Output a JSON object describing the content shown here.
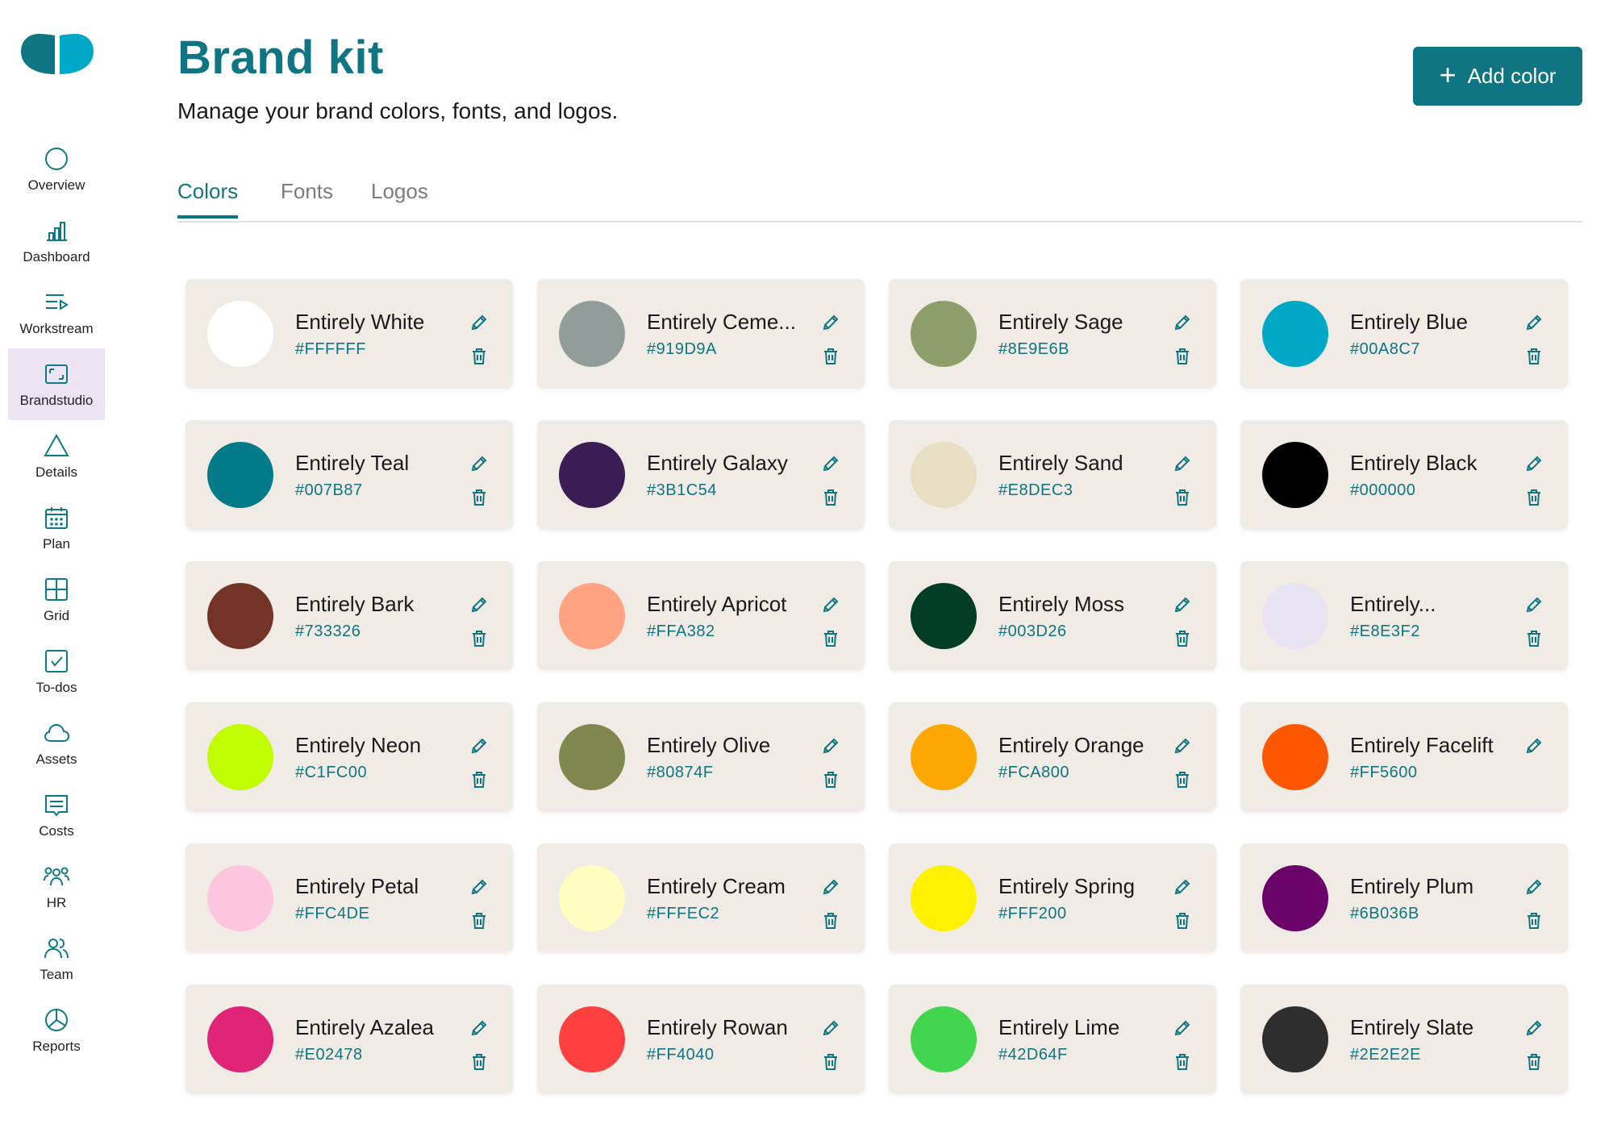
{
  "sidebar": {
    "items": [
      {
        "label": "Overview",
        "icon": "circle-icon",
        "active": false
      },
      {
        "label": "Dashboard",
        "icon": "bar-chart-icon",
        "active": false
      },
      {
        "label": "Workstream",
        "icon": "playlist-icon",
        "active": false
      },
      {
        "label": "Brandstudio",
        "icon": "frame-icon",
        "active": true
      },
      {
        "label": "Details",
        "icon": "triangle-icon",
        "active": false
      },
      {
        "label": "Plan",
        "icon": "calendar-icon",
        "active": false
      },
      {
        "label": "Grid",
        "icon": "grid-icon",
        "active": false
      },
      {
        "label": "To-dos",
        "icon": "checkbox-icon",
        "active": false
      },
      {
        "label": "Assets",
        "icon": "cloud-icon",
        "active": false
      },
      {
        "label": "Costs",
        "icon": "receipt-icon",
        "active": false
      },
      {
        "label": "HR",
        "icon": "people-group-icon",
        "active": false
      },
      {
        "label": "Team",
        "icon": "people-icon",
        "active": false
      },
      {
        "label": "Reports",
        "icon": "pie-chart-icon",
        "active": false
      }
    ]
  },
  "header": {
    "title": "Brand kit",
    "subtitle": "Manage your brand colors, fonts, and logos.",
    "add_button_label": "Add color"
  },
  "tabs": [
    {
      "label": "Colors",
      "active": true
    },
    {
      "label": "Fonts",
      "active": false
    },
    {
      "label": "Logos",
      "active": false
    }
  ],
  "colors": [
    {
      "name": "Entirely White",
      "hex": "#FFFFFF",
      "deletable": true
    },
    {
      "name": "Entirely Ceme...",
      "hex": "#919D9A",
      "deletable": true
    },
    {
      "name": "Entirely Sage",
      "hex": "#8E9E6B",
      "deletable": true
    },
    {
      "name": "Entirely Blue",
      "hex": "#00A8C7",
      "deletable": true
    },
    {
      "name": "Entirely Teal",
      "hex": "#007B87",
      "deletable": true
    },
    {
      "name": "Entirely Galaxy",
      "hex": "#3B1C54",
      "deletable": true
    },
    {
      "name": "Entirely Sand",
      "hex": "#E8DEC3",
      "deletable": true
    },
    {
      "name": "Entirely Black",
      "hex": "#000000",
      "deletable": true
    },
    {
      "name": "Entirely Bark",
      "hex": "#733326",
      "deletable": true
    },
    {
      "name": "Entirely Apricot",
      "hex": "#FFA382",
      "deletable": true
    },
    {
      "name": "Entirely Moss",
      "hex": "#003D26",
      "deletable": true
    },
    {
      "name": "Entirely...",
      "hex": "#E8E3F2",
      "deletable": true
    },
    {
      "name": "Entirely Neon",
      "hex": "#C1FC00",
      "deletable": true
    },
    {
      "name": "Entirely Olive",
      "hex": "#80874F",
      "deletable": true
    },
    {
      "name": "Entirely Orange",
      "hex": "#FCA800",
      "deletable": true
    },
    {
      "name": "Entirely Facelift",
      "hex": "#FF5600",
      "deletable": false
    },
    {
      "name": "Entirely Petal",
      "hex": "#FFC4DE",
      "deletable": true
    },
    {
      "name": "Entirely Cream",
      "hex": "#FFFEC2",
      "deletable": true
    },
    {
      "name": "Entirely Spring",
      "hex": "#FFF200",
      "deletable": true
    },
    {
      "name": "Entirely Plum",
      "hex": "#6B036B",
      "deletable": true
    },
    {
      "name": "Entirely Azalea",
      "hex": "#E02478",
      "deletable": true
    },
    {
      "name": "Entirely Rowan",
      "hex": "#FF4040",
      "deletable": true
    },
    {
      "name": "Entirely Lime",
      "hex": "#42D64F",
      "deletable": true
    },
    {
      "name": "Entirely Slate",
      "hex": "#2E2E2E",
      "deletable": true
    }
  ],
  "theme": {
    "accent": "#0F7582",
    "card_bg": "#F0EBE4",
    "active_nav_bg": "#ECE4F2"
  }
}
